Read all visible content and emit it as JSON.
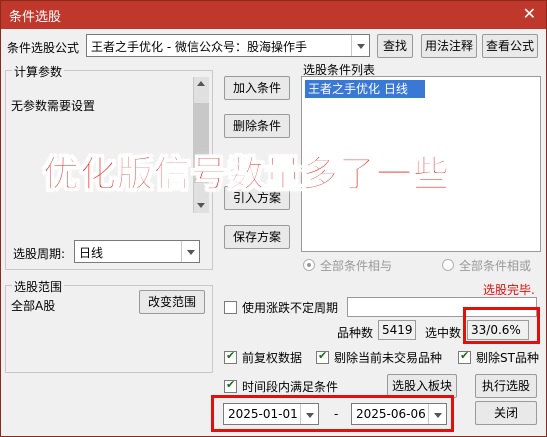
{
  "window": {
    "title": "条件选股",
    "close_glyph": "✕"
  },
  "formula": {
    "label": "条件选股公式",
    "value": "王者之手优化  -  微信公众号：股海操作手",
    "find_button": "查找",
    "usage_button": "用法注释",
    "view_button": "查看公式"
  },
  "params": {
    "group_title": "计算参数",
    "text": "无参数需要设置",
    "period_label": "选股周期:",
    "period_value": "日线"
  },
  "middle_buttons": {
    "add": "加入条件",
    "delete": "删除条件",
    "import": "引入方案",
    "save": "保存方案"
  },
  "conditions": {
    "title": "选股条件列表",
    "items": [
      "王者之手优化  日线"
    ],
    "radio_and": "全部条件相与",
    "radio_or": "全部条件相或",
    "status": "选股完毕."
  },
  "scope": {
    "group_title": "选股范围",
    "value": "全部A股",
    "change_button": "改变范围"
  },
  "options": {
    "variable_period_label": "使用涨跌不定周期",
    "count_label": "品种数",
    "count_value": "5419",
    "selected_label": "选中数",
    "selected_value": "33/0.6%",
    "prev_adjust_label": "前复权数据",
    "exclude_untraded_label": "剔除当前未交易品种",
    "exclude_st_label": "剔除ST品种",
    "time_range_label": "时间段内满足条件",
    "date_from": "2025-01-01",
    "date_sep": "-",
    "date_to": "2025-06-06"
  },
  "actions": {
    "to_block": "选股入板块",
    "run": "执行选股",
    "close": "关闭"
  },
  "overlay_text": "优化版信号数量多了一些",
  "colors": {
    "title_bar": "#c0382b",
    "highlight": "#e01010",
    "list_selection": "#3a78d6",
    "status_red": "#e01010"
  }
}
